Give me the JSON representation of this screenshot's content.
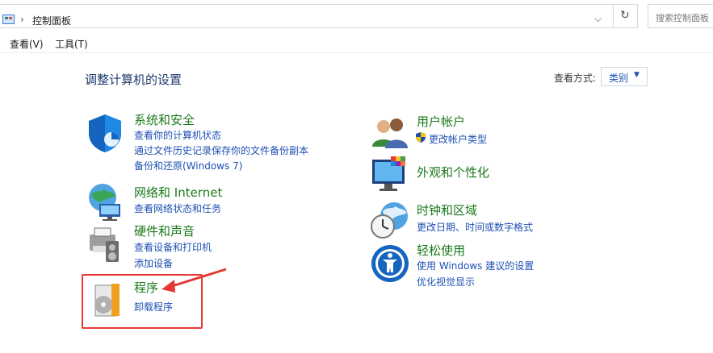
{
  "address": {
    "separator": "›",
    "crumb": "控制面板",
    "dropdown": "⌵",
    "refresh": "↻",
    "search_placeholder": "搜索控制面板"
  },
  "menu": [
    {
      "label": "查看(V)"
    },
    {
      "label": "工具(T)"
    }
  ],
  "main": {
    "title": "调整计算机的设置",
    "view_label": "查看方式:",
    "view_value": "类别",
    "view_caret": "▼"
  },
  "left_categories": [
    {
      "title": "系统和安全",
      "icon": "shield-icon",
      "links": [
        "查看你的计算机状态",
        "通过文件历史记录保存你的文件备份副本",
        "备份和还原(Windows 7)"
      ]
    },
    {
      "title": "网络和 Internet",
      "icon": "network-globe-icon",
      "links": [
        "查看网络状态和任务"
      ]
    },
    {
      "title": "硬件和声音",
      "icon": "printer-speaker-icon",
      "links": [
        "查看设备和打印机",
        "添加设备"
      ]
    },
    {
      "title": "程序",
      "icon": "programs-disc-icon",
      "links": [
        "卸载程序"
      ]
    }
  ],
  "right_categories": [
    {
      "title": "用户帐户",
      "icon": "users-icon",
      "links": [
        "更改帐户类型"
      ]
    },
    {
      "title": "外观和个性化",
      "icon": "monitor-palette-icon",
      "links": []
    },
    {
      "title": "时钟和区域",
      "icon": "clock-globe-icon",
      "links": [
        "更改日期、时间或数字格式"
      ]
    },
    {
      "title": "轻松使用",
      "icon": "ease-of-access-icon",
      "links": [
        "使用 Windows 建议的设置",
        "优化视觉显示"
      ]
    }
  ],
  "colors": {
    "link": "#1e50b4",
    "category_title": "#1a7a1a",
    "annotation": "#e53935"
  }
}
